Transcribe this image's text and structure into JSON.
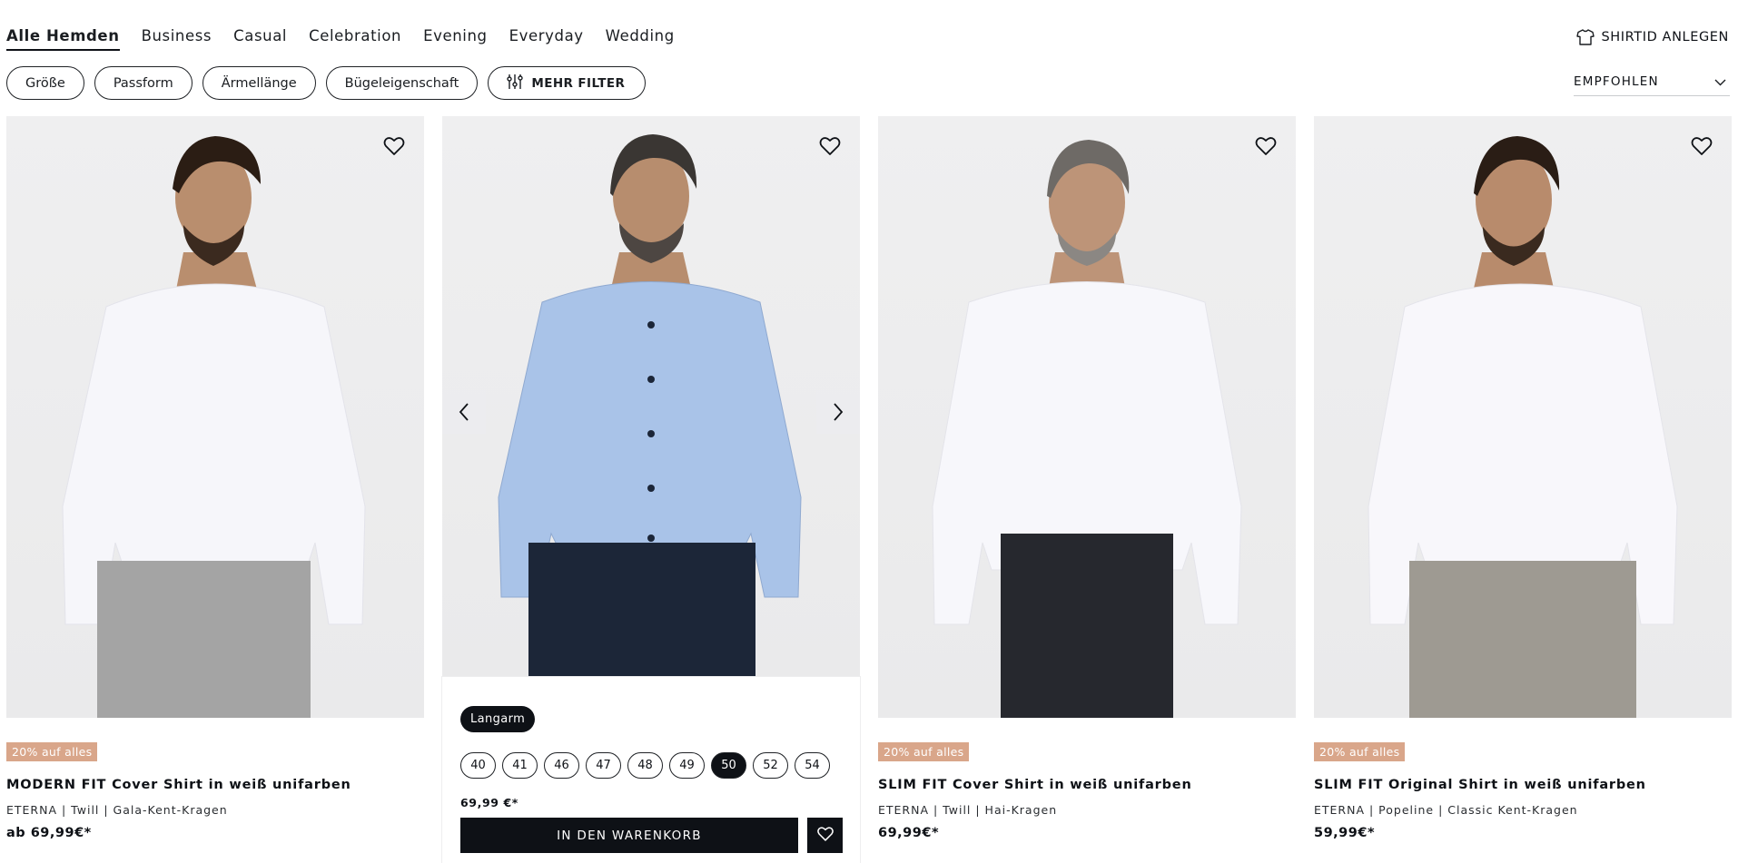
{
  "nav": {
    "tabs": [
      {
        "label": "Alle Hemden"
      },
      {
        "label": "Business"
      },
      {
        "label": "Casual"
      },
      {
        "label": "Celebration"
      },
      {
        "label": "Evening"
      },
      {
        "label": "Everyday"
      },
      {
        "label": "Wedding"
      }
    ],
    "shirtid_label": "SHIRTID ANLEGEN"
  },
  "filters": {
    "items": [
      {
        "label": "Größe"
      },
      {
        "label": "Passform"
      },
      {
        "label": "Ärmellänge"
      },
      {
        "label": "Bügeleigenschaft"
      }
    ],
    "more_label": "MEHR FILTER"
  },
  "sort": {
    "label": "EMPFOHLEN"
  },
  "products": [
    {
      "badge": "20% auf alles",
      "title": "MODERN FIT Cover Shirt in weiß unifarben",
      "sub": "ETERNA | Twill | Gala-Kent-Kragen",
      "price": "ab 69,99€*",
      "shirt_color": "#f6f6fa",
      "pants_color": "#a4a4a4"
    },
    {
      "sleeve_chip": "Langarm",
      "sizes": [
        "40",
        "41",
        "46",
        "47",
        "48",
        "49",
        "50",
        "52",
        "54"
      ],
      "selected_size": "50",
      "price": "69,99 €*",
      "cart_label": "IN DEN WARENKORB",
      "shirt_color": "#a9c3e8",
      "pants_color": "#1c2638"
    },
    {
      "badge": "20% auf alles",
      "title": "SLIM FIT Cover Shirt in weiß unifarben",
      "sub": "ETERNA | Twill | Hai-Kragen",
      "price": "69,99€*",
      "shirt_color": "#f7f7fb",
      "pants_color": "#26282e"
    },
    {
      "badge": "20% auf alles",
      "title": "SLIM FIT Original Shirt in weiß unifarben",
      "sub": "ETERNA | Popeline | Classic Kent-Kragen",
      "price": "59,99€*",
      "shirt_color": "#f8f7fb",
      "pants_color": "#9e9a92"
    }
  ]
}
